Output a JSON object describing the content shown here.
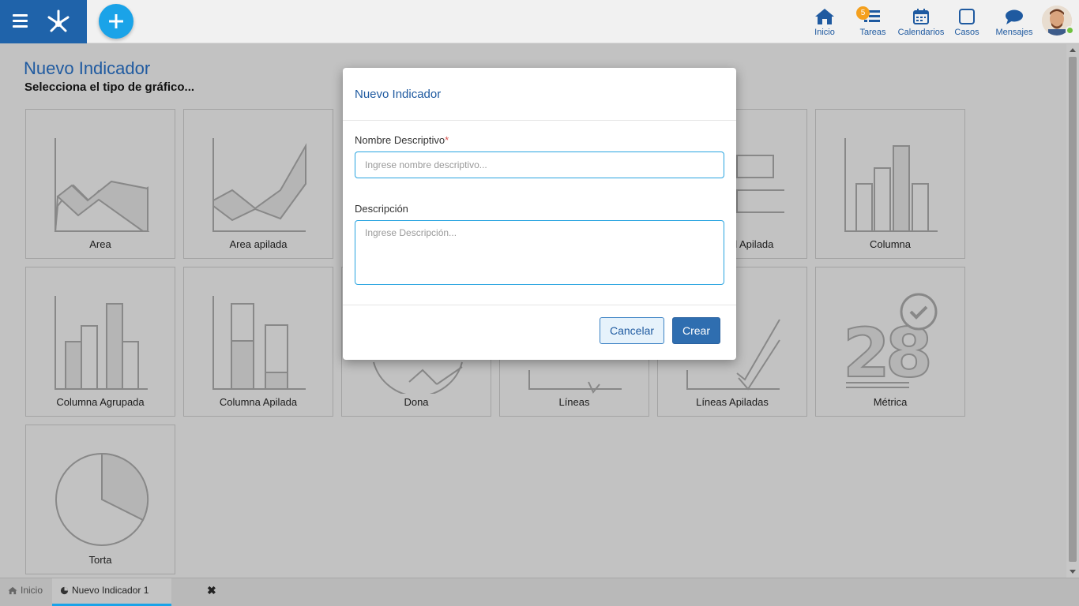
{
  "topbar": {
    "nav": [
      {
        "label": "Inicio",
        "icon": "home-icon"
      },
      {
        "label": "Tareas",
        "icon": "tasks-icon",
        "badge": "5"
      },
      {
        "label": "Calendarios",
        "icon": "calendar-icon"
      },
      {
        "label": "Casos",
        "icon": "cases-icon"
      },
      {
        "label": "Mensajes",
        "icon": "messages-icon"
      }
    ],
    "accent": "#1f63aa",
    "add_color": "#1aa3e8"
  },
  "page": {
    "title": "Nuevo Indicador",
    "subtitle": "Selecciona el tipo de gráfico..."
  },
  "tiles": [
    {
      "label": "Area",
      "icon": "area-chart-icon"
    },
    {
      "label": "Area apilada",
      "icon": "stacked-area-chart-icon"
    },
    {
      "label": "Horizontal Apilada",
      "icon": "stacked-horizontal-bar-icon"
    },
    {
      "label": "Columna",
      "icon": "column-chart-icon"
    },
    {
      "label": "Columna Agrupada",
      "icon": "grouped-column-chart-icon"
    },
    {
      "label": "Columna Apilada",
      "icon": "stacked-column-chart-icon"
    },
    {
      "label": "Dona",
      "icon": "donut-chart-icon"
    },
    {
      "label": "Líneas",
      "icon": "line-chart-icon"
    },
    {
      "label": "Líneas Apiladas",
      "icon": "stacked-line-chart-icon"
    },
    {
      "label": "Métrica",
      "icon": "metric-icon"
    },
    {
      "label": "Torta",
      "icon": "pie-chart-icon"
    }
  ],
  "modal": {
    "title": "Nuevo Indicador",
    "name_label": "Nombre Descriptivo",
    "required_mark": "*",
    "name_placeholder": "Ingrese nombre descriptivo...",
    "name_value": "",
    "desc_label": "Descripción",
    "desc_placeholder": "Ingrese Descripción...",
    "desc_value": "",
    "cancel_label": "Cancelar",
    "create_label": "Crear"
  },
  "tabs": [
    {
      "label": "Inicio",
      "icon": "home-icon"
    },
    {
      "label": "Nuevo Indicador 1",
      "icon": "pie-chart-icon",
      "active": true
    }
  ]
}
